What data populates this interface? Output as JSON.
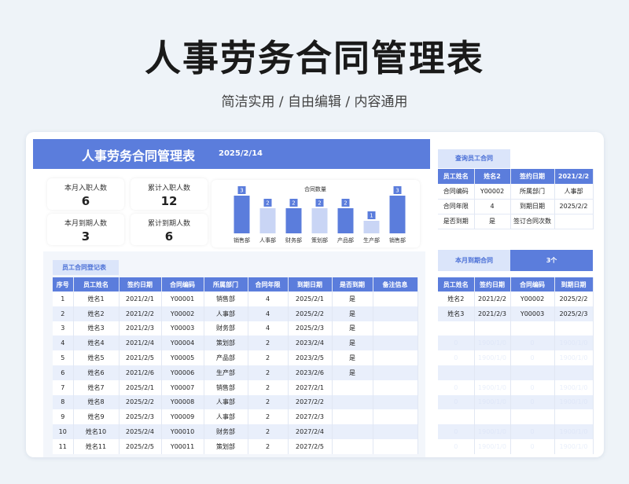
{
  "page": {
    "title": "人事劳务合同管理表",
    "subtitle": "简洁实用 / 自由编辑 / 内容通用"
  },
  "banner": {
    "title": "人事劳务合同管理表",
    "date": "2025/2/14"
  },
  "stats": [
    {
      "label": "本月入职人数",
      "value": "6"
    },
    {
      "label": "累计入职人数",
      "value": "12"
    },
    {
      "label": "本月到期人数",
      "value": "3"
    },
    {
      "label": "累计到期人数",
      "value": "6"
    }
  ],
  "chart_data": {
    "type": "bar",
    "title": "合同数量",
    "categories": [
      "销售部",
      "人事部",
      "财务部",
      "策划部",
      "产品部",
      "生产部",
      "销售部"
    ],
    "values": [
      3,
      2,
      2,
      2,
      2,
      1,
      3
    ],
    "ylim": [
      0,
      3
    ],
    "colors": [
      "#5b7ddc",
      "#c9d5f5"
    ],
    "grid": false
  },
  "main_table": {
    "tag": "员工合同登记表",
    "headers": [
      "序号",
      "员工姓名",
      "签约日期",
      "合同编码",
      "所属部门",
      "合同年限",
      "到期日期",
      "是否到期",
      "备注信息"
    ],
    "rows": [
      [
        "1",
        "姓名1",
        "2021/2/1",
        "Y00001",
        "销售部",
        "4",
        "2025/2/1",
        "是",
        ""
      ],
      [
        "2",
        "姓名2",
        "2021/2/2",
        "Y00002",
        "人事部",
        "4",
        "2025/2/2",
        "是",
        ""
      ],
      [
        "3",
        "姓名3",
        "2021/2/3",
        "Y00003",
        "财务部",
        "4",
        "2025/2/3",
        "是",
        ""
      ],
      [
        "4",
        "姓名4",
        "2021/2/4",
        "Y00004",
        "策划部",
        "2",
        "2023/2/4",
        "是",
        ""
      ],
      [
        "5",
        "姓名5",
        "2021/2/5",
        "Y00005",
        "产品部",
        "2",
        "2023/2/5",
        "是",
        ""
      ],
      [
        "6",
        "姓名6",
        "2021/2/6",
        "Y00006",
        "生产部",
        "2",
        "2023/2/6",
        "是",
        ""
      ],
      [
        "7",
        "姓名7",
        "2025/2/1",
        "Y00007",
        "销售部",
        "2",
        "2027/2/1",
        "",
        ""
      ],
      [
        "8",
        "姓名8",
        "2025/2/2",
        "Y00008",
        "人事部",
        "2",
        "2027/2/2",
        "",
        ""
      ],
      [
        "9",
        "姓名9",
        "2025/2/3",
        "Y00009",
        "人事部",
        "2",
        "2027/2/3",
        "",
        ""
      ],
      [
        "10",
        "姓名10",
        "2025/2/4",
        "Y00010",
        "财务部",
        "2",
        "2027/2/4",
        "",
        ""
      ],
      [
        "11",
        "姓名11",
        "2025/2/5",
        "Y00011",
        "策划部",
        "2",
        "2027/2/5",
        "",
        ""
      ]
    ]
  },
  "query": {
    "tag": "查询员工合同",
    "header": [
      "员工姓名",
      "姓名2",
      "签约日期",
      "2021/2/2"
    ],
    "rows": [
      [
        "合同编码",
        "Y00002",
        "所属部门",
        "人事部"
      ],
      [
        "合同年限",
        "4",
        "到期日期",
        "2025/2/2"
      ],
      [
        "是否到期",
        "是",
        "签订合同次数",
        ""
      ]
    ]
  },
  "due": {
    "label": "本月到期合同",
    "count": "3个",
    "headers": [
      "员工姓名",
      "签约日期",
      "合同编码",
      "到期日期"
    ],
    "rows": [
      [
        "姓名2",
        "2021/2/2",
        "Y00002",
        "2025/2/2"
      ],
      [
        "姓名3",
        "2021/2/3",
        "Y00003",
        "2025/2/3"
      ]
    ],
    "filler_rows": [
      [
        "",
        "",
        "",
        ""
      ],
      [
        "0",
        "1900/1/0",
        "0",
        "1900/1/0"
      ],
      [
        "0",
        "1900/1/0",
        "0",
        "1900/1/0"
      ],
      [
        "",
        "",
        "",
        ""
      ],
      [
        "0",
        "1900/1/0",
        "0",
        "1900/1/0"
      ],
      [
        "0",
        "1900/1/0",
        "0",
        "1900/1/0"
      ],
      [
        "",
        "",
        "",
        ""
      ],
      [
        "0",
        "1900/1/0",
        "0",
        "1900/1/0"
      ],
      [
        "0",
        "1900/1/0",
        "0",
        "1900/1/0"
      ]
    ]
  }
}
